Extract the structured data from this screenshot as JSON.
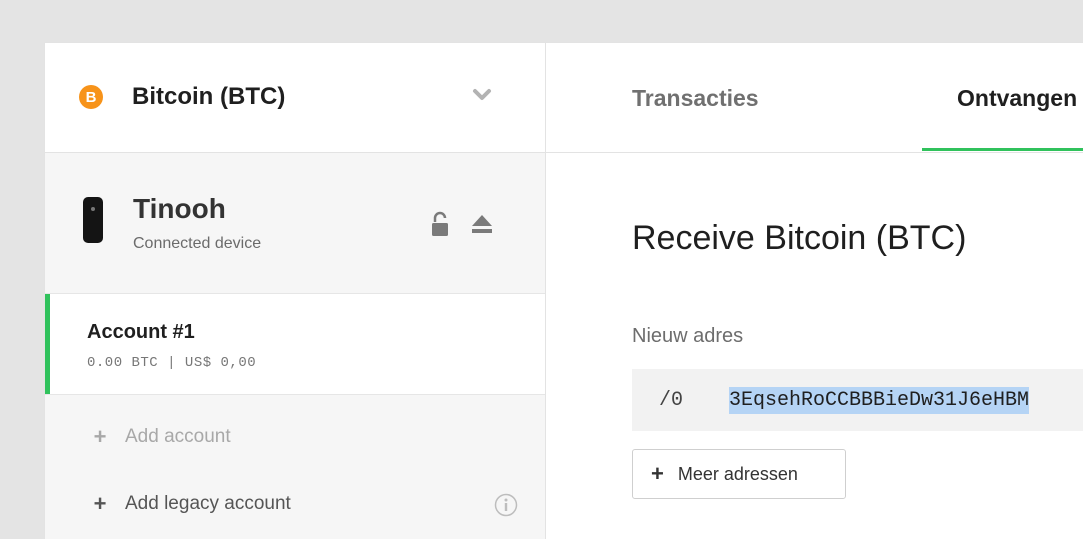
{
  "coin": {
    "name": "Bitcoin (BTC)",
    "logo_glyph": "B",
    "logo_color": "#f7931a"
  },
  "device": {
    "name": "Tinooh",
    "status": "Connected device"
  },
  "account": {
    "title": "Account #1",
    "balance": "0.00 BTC | US$ 0,00",
    "accent": "#30c25c"
  },
  "sidebar_actions": {
    "add_account": "Add account",
    "add_legacy": "Add legacy account"
  },
  "tabs": [
    {
      "label": "Transacties",
      "active": false
    },
    {
      "label": "Ontvangen",
      "active": true
    }
  ],
  "receive": {
    "title": "Receive Bitcoin (BTC)",
    "new_address_label": "Nieuw adres",
    "path": "/0",
    "address": "3EqsehRoCCBBBieDw31J6eHBM",
    "more_addresses": "Meer adressen"
  },
  "icons": [
    "bitcoin-logo",
    "chevron-down-icon",
    "device-icon",
    "unlock-icon",
    "eject-icon",
    "plus-icon",
    "info-icon"
  ]
}
